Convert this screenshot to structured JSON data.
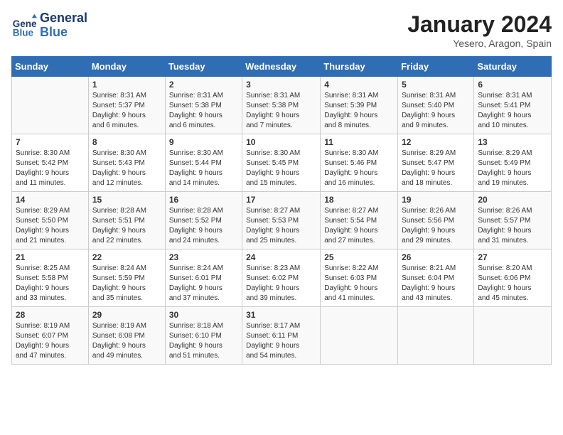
{
  "header": {
    "logo_line1": "General",
    "logo_line2": "Blue",
    "month_title": "January 2024",
    "location": "Yesero, Aragon, Spain"
  },
  "days_of_week": [
    "Sunday",
    "Monday",
    "Tuesday",
    "Wednesday",
    "Thursday",
    "Friday",
    "Saturday"
  ],
  "weeks": [
    [
      {
        "day": "",
        "text": ""
      },
      {
        "day": "1",
        "text": "Sunrise: 8:31 AM\nSunset: 5:37 PM\nDaylight: 9 hours\nand 6 minutes."
      },
      {
        "day": "2",
        "text": "Sunrise: 8:31 AM\nSunset: 5:38 PM\nDaylight: 9 hours\nand 6 minutes."
      },
      {
        "day": "3",
        "text": "Sunrise: 8:31 AM\nSunset: 5:38 PM\nDaylight: 9 hours\nand 7 minutes."
      },
      {
        "day": "4",
        "text": "Sunrise: 8:31 AM\nSunset: 5:39 PM\nDaylight: 9 hours\nand 8 minutes."
      },
      {
        "day": "5",
        "text": "Sunrise: 8:31 AM\nSunset: 5:40 PM\nDaylight: 9 hours\nand 9 minutes."
      },
      {
        "day": "6",
        "text": "Sunrise: 8:31 AM\nSunset: 5:41 PM\nDaylight: 9 hours\nand 10 minutes."
      }
    ],
    [
      {
        "day": "7",
        "text": "Sunrise: 8:30 AM\nSunset: 5:42 PM\nDaylight: 9 hours\nand 11 minutes."
      },
      {
        "day": "8",
        "text": "Sunrise: 8:30 AM\nSunset: 5:43 PM\nDaylight: 9 hours\nand 12 minutes."
      },
      {
        "day": "9",
        "text": "Sunrise: 8:30 AM\nSunset: 5:44 PM\nDaylight: 9 hours\nand 14 minutes."
      },
      {
        "day": "10",
        "text": "Sunrise: 8:30 AM\nSunset: 5:45 PM\nDaylight: 9 hours\nand 15 minutes."
      },
      {
        "day": "11",
        "text": "Sunrise: 8:30 AM\nSunset: 5:46 PM\nDaylight: 9 hours\nand 16 minutes."
      },
      {
        "day": "12",
        "text": "Sunrise: 8:29 AM\nSunset: 5:47 PM\nDaylight: 9 hours\nand 18 minutes."
      },
      {
        "day": "13",
        "text": "Sunrise: 8:29 AM\nSunset: 5:49 PM\nDaylight: 9 hours\nand 19 minutes."
      }
    ],
    [
      {
        "day": "14",
        "text": "Sunrise: 8:29 AM\nSunset: 5:50 PM\nDaylight: 9 hours\nand 21 minutes."
      },
      {
        "day": "15",
        "text": "Sunrise: 8:28 AM\nSunset: 5:51 PM\nDaylight: 9 hours\nand 22 minutes."
      },
      {
        "day": "16",
        "text": "Sunrise: 8:28 AM\nSunset: 5:52 PM\nDaylight: 9 hours\nand 24 minutes."
      },
      {
        "day": "17",
        "text": "Sunrise: 8:27 AM\nSunset: 5:53 PM\nDaylight: 9 hours\nand 25 minutes."
      },
      {
        "day": "18",
        "text": "Sunrise: 8:27 AM\nSunset: 5:54 PM\nDaylight: 9 hours\nand 27 minutes."
      },
      {
        "day": "19",
        "text": "Sunrise: 8:26 AM\nSunset: 5:56 PM\nDaylight: 9 hours\nand 29 minutes."
      },
      {
        "day": "20",
        "text": "Sunrise: 8:26 AM\nSunset: 5:57 PM\nDaylight: 9 hours\nand 31 minutes."
      }
    ],
    [
      {
        "day": "21",
        "text": "Sunrise: 8:25 AM\nSunset: 5:58 PM\nDaylight: 9 hours\nand 33 minutes."
      },
      {
        "day": "22",
        "text": "Sunrise: 8:24 AM\nSunset: 5:59 PM\nDaylight: 9 hours\nand 35 minutes."
      },
      {
        "day": "23",
        "text": "Sunrise: 8:24 AM\nSunset: 6:01 PM\nDaylight: 9 hours\nand 37 minutes."
      },
      {
        "day": "24",
        "text": "Sunrise: 8:23 AM\nSunset: 6:02 PM\nDaylight: 9 hours\nand 39 minutes."
      },
      {
        "day": "25",
        "text": "Sunrise: 8:22 AM\nSunset: 6:03 PM\nDaylight: 9 hours\nand 41 minutes."
      },
      {
        "day": "26",
        "text": "Sunrise: 8:21 AM\nSunset: 6:04 PM\nDaylight: 9 hours\nand 43 minutes."
      },
      {
        "day": "27",
        "text": "Sunrise: 8:20 AM\nSunset: 6:06 PM\nDaylight: 9 hours\nand 45 minutes."
      }
    ],
    [
      {
        "day": "28",
        "text": "Sunrise: 8:19 AM\nSunset: 6:07 PM\nDaylight: 9 hours\nand 47 minutes."
      },
      {
        "day": "29",
        "text": "Sunrise: 8:19 AM\nSunset: 6:08 PM\nDaylight: 9 hours\nand 49 minutes."
      },
      {
        "day": "30",
        "text": "Sunrise: 8:18 AM\nSunset: 6:10 PM\nDaylight: 9 hours\nand 51 minutes."
      },
      {
        "day": "31",
        "text": "Sunrise: 8:17 AM\nSunset: 6:11 PM\nDaylight: 9 hours\nand 54 minutes."
      },
      {
        "day": "",
        "text": ""
      },
      {
        "day": "",
        "text": ""
      },
      {
        "day": "",
        "text": ""
      }
    ]
  ]
}
